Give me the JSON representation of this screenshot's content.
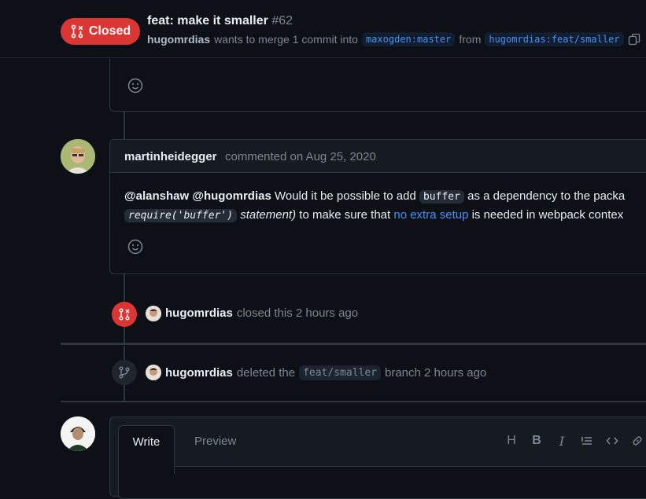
{
  "header": {
    "state_label": "Closed",
    "title": "feat: make it smaller",
    "number": "#62",
    "author": "hugomrdias",
    "merge_text": "wants to merge 1 commit into",
    "base_branch": "maxogden:master",
    "from_text": "from",
    "head_branch": "hugomrdias:feat/smaller",
    "state_color": "#da3633"
  },
  "comment": {
    "author": "martinheidegger",
    "meta": "commented on Aug 25, 2020",
    "mention1": "@alanshaw",
    "mention2": "@hugomrdias",
    "text1": "Would it be possible to add",
    "code1": "buffer",
    "text2": "as a dependency to the packa",
    "code2": "require('buffer')",
    "text3": "statement)",
    "text4": "to make sure that",
    "link": "no extra setup",
    "text5": "is needed in webpack contex"
  },
  "events": [
    {
      "actor": "hugomrdias",
      "action": "closed this 2 hours ago",
      "icon": "git-pull-request-closed-icon"
    },
    {
      "actor": "hugomrdias",
      "action_pre": "deleted the",
      "branch": "feat/smaller",
      "action_post": "branch 2 hours ago",
      "icon": "git-branch-icon"
    }
  ],
  "composer": {
    "tab_write": "Write",
    "tab_preview": "Preview",
    "toolbar_icons": [
      "heading-icon",
      "bold-icon",
      "italic-icon",
      "quote-icon",
      "code-icon",
      "link-icon"
    ],
    "toolbar_glyphs": {
      "heading": "H",
      "bold": "B",
      "italic": "I"
    }
  }
}
